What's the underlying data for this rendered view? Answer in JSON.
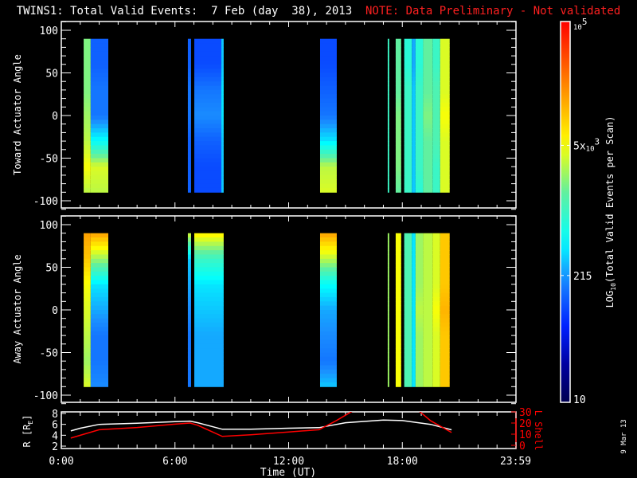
{
  "title": {
    "main": "TWINS1: Total Valid Events:  7 Feb (day  38), 2013",
    "note": "NOTE: Data Preliminary - Not validated"
  },
  "footer_date": "9 Mar 13",
  "colors": {
    "background": "#000000",
    "axes": "#ffffff",
    "note": "#ff2020",
    "l_shell": "#ff0000",
    "r_line": "#ffffff"
  },
  "chart_data": [
    {
      "type": "heatmap",
      "title": "Toward Actuator Angle",
      "ylabel": "Toward Actuator Angle",
      "xlabel": "",
      "xlim": [
        0,
        24
      ],
      "ylim": [
        -110,
        110
      ],
      "ytick_labels": [
        "100",
        "50",
        "0",
        "-50",
        "-100"
      ],
      "yticks": [
        100,
        50,
        0,
        -50,
        -100
      ],
      "profile_angles": [
        90,
        60,
        30,
        0,
        -30,
        -60,
        -90
      ],
      "value_units": "log10 counts",
      "bands": [
        {
          "t": [
            1.18,
            1.55
          ],
          "v": [
            3.3,
            3.3,
            3.3,
            3.4,
            3.5,
            3.7,
            3.5
          ]
        },
        {
          "t": [
            1.55,
            2.48
          ],
          "v": [
            2.1,
            2.1,
            2.2,
            2.2,
            2.7,
            3.6,
            3.5
          ]
        },
        {
          "t": [
            6.68,
            6.85
          ],
          "v": [
            2.1,
            2.1,
            2.2,
            2.2,
            2.1,
            2.1,
            2.1
          ]
        },
        {
          "t": [
            7.02,
            8.45
          ],
          "v": [
            2.0,
            2.0,
            2.2,
            2.3,
            2.1,
            2.0,
            2.0
          ]
        },
        {
          "t": [
            8.45,
            8.57
          ],
          "v": [
            2.5,
            2.5,
            2.6,
            2.6,
            2.5,
            2.5,
            2.5
          ]
        },
        {
          "t": [
            13.66,
            14.54
          ],
          "v": [
            2.0,
            2.0,
            2.1,
            2.2,
            2.6,
            3.5,
            3.6
          ]
        },
        {
          "t": [
            17.23,
            17.31
          ],
          "v": [
            3.0,
            3.0,
            3.0,
            3.0,
            3.0,
            3.0,
            3.0
          ]
        },
        {
          "t": [
            17.65,
            17.94
          ],
          "v": [
            3.2,
            3.2,
            3.2,
            3.3,
            3.3,
            3.3,
            3.2
          ]
        },
        {
          "t": [
            18.1,
            18.5
          ],
          "v": [
            2.9,
            2.9,
            3.0,
            3.0,
            3.0,
            3.0,
            3.0
          ]
        },
        {
          "t": [
            18.5,
            18.7
          ],
          "v": [
            2.4,
            2.4,
            2.5,
            2.5,
            2.5,
            2.5,
            2.5
          ]
        },
        {
          "t": [
            18.7,
            19.1
          ],
          "v": [
            2.9,
            2.9,
            3.0,
            3.0,
            3.0,
            3.0,
            2.9
          ]
        },
        {
          "t": [
            19.1,
            19.6
          ],
          "v": [
            3.2,
            3.2,
            3.2,
            3.3,
            3.2,
            3.2,
            3.2
          ]
        },
        {
          "t": [
            19.6,
            20.0
          ],
          "v": [
            3.0,
            3.0,
            3.1,
            3.1,
            3.1,
            3.0,
            3.0
          ]
        },
        {
          "t": [
            20.0,
            20.5
          ],
          "v": [
            3.6,
            3.6,
            3.6,
            3.7,
            3.6,
            3.6,
            3.6
          ]
        }
      ]
    },
    {
      "type": "heatmap",
      "title": "Away Actuator Angle",
      "ylabel": "Away Actuator Angle",
      "xlabel": "",
      "xlim": [
        0,
        24
      ],
      "ylim": [
        -110,
        110
      ],
      "ytick_labels": [
        "100",
        "50",
        "0",
        "-50",
        "-100"
      ],
      "yticks": [
        100,
        50,
        0,
        -50,
        -100
      ],
      "profile_angles": [
        90,
        60,
        30,
        0,
        -30,
        -60,
        -90
      ],
      "value_units": "log10 counts",
      "bands": [
        {
          "t": [
            1.18,
            1.55
          ],
          "v": [
            4.2,
            4.0,
            3.7,
            3.6,
            3.5,
            3.4,
            3.6
          ]
        },
        {
          "t": [
            1.55,
            2.48
          ],
          "v": [
            4.2,
            3.4,
            2.6,
            2.4,
            2.2,
            2.2,
            2.3
          ]
        },
        {
          "t": [
            6.68,
            6.85
          ],
          "v": [
            3.6,
            2.5,
            2.4,
            2.3,
            2.2,
            2.2,
            2.2
          ]
        },
        {
          "t": [
            7.02,
            8.57
          ],
          "v": [
            3.8,
            3.0,
            2.6,
            2.5,
            2.4,
            2.4,
            2.4
          ]
        },
        {
          "t": [
            13.66,
            14.54
          ],
          "v": [
            4.2,
            3.5,
            2.7,
            2.4,
            2.3,
            2.2,
            2.5
          ]
        },
        {
          "t": [
            17.23,
            17.31
          ],
          "v": [
            3.4,
            3.4,
            3.4,
            3.4,
            3.4,
            3.4,
            3.4
          ]
        },
        {
          "t": [
            17.65,
            17.94
          ],
          "v": [
            3.7,
            3.7,
            3.7,
            3.7,
            3.7,
            3.7,
            3.7
          ]
        },
        {
          "t": [
            18.1,
            18.5
          ],
          "v": [
            3.1,
            3.1,
            3.1,
            3.1,
            3.1,
            3.1,
            3.1
          ]
        },
        {
          "t": [
            18.5,
            18.7
          ],
          "v": [
            2.6,
            2.6,
            2.6,
            2.6,
            2.6,
            2.6,
            2.6
          ]
        },
        {
          "t": [
            18.7,
            19.1
          ],
          "v": [
            3.4,
            3.4,
            3.4,
            3.5,
            3.4,
            3.4,
            3.4
          ]
        },
        {
          "t": [
            19.1,
            19.6
          ],
          "v": [
            3.5,
            3.5,
            3.5,
            3.5,
            3.5,
            3.5,
            3.5
          ]
        },
        {
          "t": [
            19.6,
            20.0
          ],
          "v": [
            3.6,
            3.6,
            3.6,
            3.7,
            3.6,
            3.6,
            3.6
          ]
        },
        {
          "t": [
            20.0,
            20.5
          ],
          "v": [
            4.0,
            4.0,
            4.0,
            4.1,
            4.0,
            4.0,
            4.0
          ]
        }
      ]
    },
    {
      "type": "line",
      "title": "Ephemeris",
      "xlabel": "Time (UT)",
      "ylabel": "R [R",
      "ylabel_sub": "E",
      "ylabel_end": "]",
      "y2label": "L Shell",
      "xlim": [
        0,
        24
      ],
      "ylim": [
        2,
        8
      ],
      "y2lim": [
        0,
        30
      ],
      "xtick_labels": [
        "0:00",
        "6:00",
        "12:00",
        "18:00",
        "23:59"
      ],
      "xticks": [
        0,
        6,
        12,
        18,
        23.98
      ],
      "ytick_labels": [
        "8",
        "6",
        "4",
        "2"
      ],
      "yticks": [
        8,
        6,
        4,
        2
      ],
      "y2tick_labels": [
        "30",
        "20",
        "10",
        "0"
      ],
      "y2ticks": [
        30,
        20,
        10,
        0
      ],
      "series": [
        {
          "name": "R",
          "axis": "left",
          "x": [
            0.5,
            1.0,
            2.0,
            4.0,
            6.0,
            6.8,
            7.2,
            8.5,
            10.0,
            12.0,
            13.6,
            15.0,
            17.0,
            18.0,
            19.5,
            20.6
          ],
          "y": [
            4.8,
            5.3,
            6.0,
            6.2,
            6.5,
            6.6,
            6.3,
            5.1,
            5.1,
            5.3,
            5.4,
            6.3,
            6.8,
            6.7,
            6.0,
            5.0
          ]
        },
        {
          "name": "L Shell",
          "axis": "right",
          "x": [
            0.5,
            1.0,
            2.0,
            4.0,
            6.0,
            6.8,
            7.2,
            8.5,
            10.0,
            12.0,
            13.6,
            14.5,
            15.5,
            16.0,
            18.8,
            19.5,
            20.6
          ],
          "y": [
            6.5,
            9.0,
            14.0,
            16.0,
            19.0,
            20.0,
            18.0,
            8.0,
            9.5,
            12.0,
            14.0,
            22.0,
            32.0,
            40.0,
            32.0,
            22.0,
            11.5
          ]
        }
      ]
    }
  ],
  "colorbar": {
    "label": "LOG",
    "label_sub": "10",
    "label_rest": "(Total Valid  Events per Scan)",
    "range_log10": [
      1,
      5
    ],
    "ticks": [
      {
        "value": 5,
        "label": "10",
        "sup": "5"
      },
      {
        "value": 3.699,
        "label": "5x",
        "sub": "10",
        "sup": "3"
      },
      {
        "value": 2.332,
        "label": "215"
      },
      {
        "value": 1,
        "label": "10"
      }
    ]
  }
}
